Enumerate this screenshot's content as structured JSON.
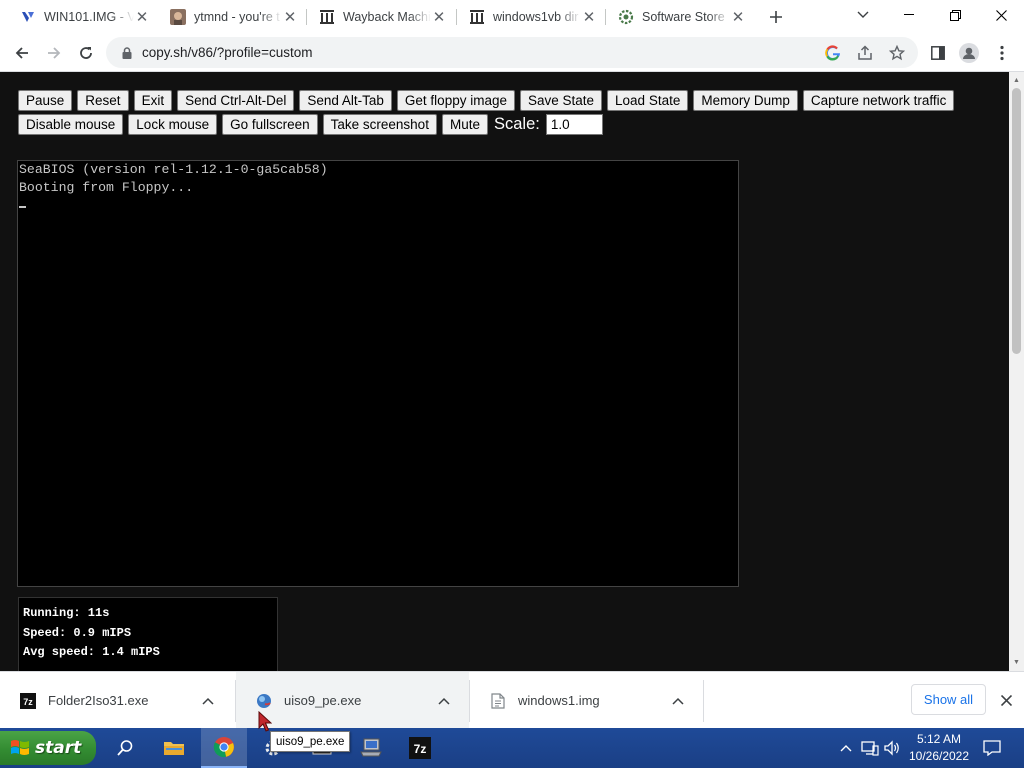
{
  "browser": {
    "tabs": [
      {
        "title": "WIN101.IMG - V",
        "favicon": "v86-icon",
        "active": true
      },
      {
        "title": "ytmnd - you're t",
        "favicon": "ytmnd-avatar-icon",
        "active": false
      },
      {
        "title": "Wayback Machi",
        "favicon": "archive-building-icon",
        "active": false
      },
      {
        "title": "windows1vb dir",
        "favicon": "archive-building-icon",
        "active": false
      },
      {
        "title": "Software Store",
        "favicon": "software-store-icon",
        "active": false
      }
    ],
    "address_bar": {
      "url": "copy.sh/v86/?profile=custom"
    }
  },
  "emulator": {
    "buttons_row1": [
      "Pause",
      "Reset",
      "Exit",
      "Send Ctrl-Alt-Del",
      "Send Alt-Tab",
      "Get floppy image",
      "Save State",
      "Load State",
      "Memory Dump",
      "Capture network traffic"
    ],
    "buttons_row2": [
      "Disable mouse",
      "Lock mouse",
      "Go fullscreen",
      "Take screenshot",
      "Mute"
    ],
    "scale_label": "Scale:",
    "scale_value": "1.0",
    "screen_lines": [
      "SeaBIOS (version rel-1.12.1-0-ga5cab58)",
      "Booting from Floppy..."
    ],
    "stats": {
      "running": "Running: 11s",
      "speed": "Speed: 0.9 mIPS",
      "avg_speed": "Avg speed: 1.4 mIPS"
    }
  },
  "downloads": {
    "items": [
      {
        "name": "Folder2Iso31.exe",
        "icon": "7zip-icon"
      },
      {
        "name": "uiso9_pe.exe",
        "icon": "ultraiso-globe-icon"
      },
      {
        "name": "windows1.img",
        "icon": "file-icon"
      }
    ],
    "show_all_label": "Show all",
    "tooltip": "uiso9_pe.exe"
  },
  "taskbar": {
    "start_label": "start",
    "time": "5:12 AM",
    "date": "10/26/2022"
  },
  "colors": {
    "page_background": "#111111",
    "taskbar_blue": "#1f4a98",
    "start_green": "#3b9a38",
    "link_blue": "#1a73e8"
  }
}
